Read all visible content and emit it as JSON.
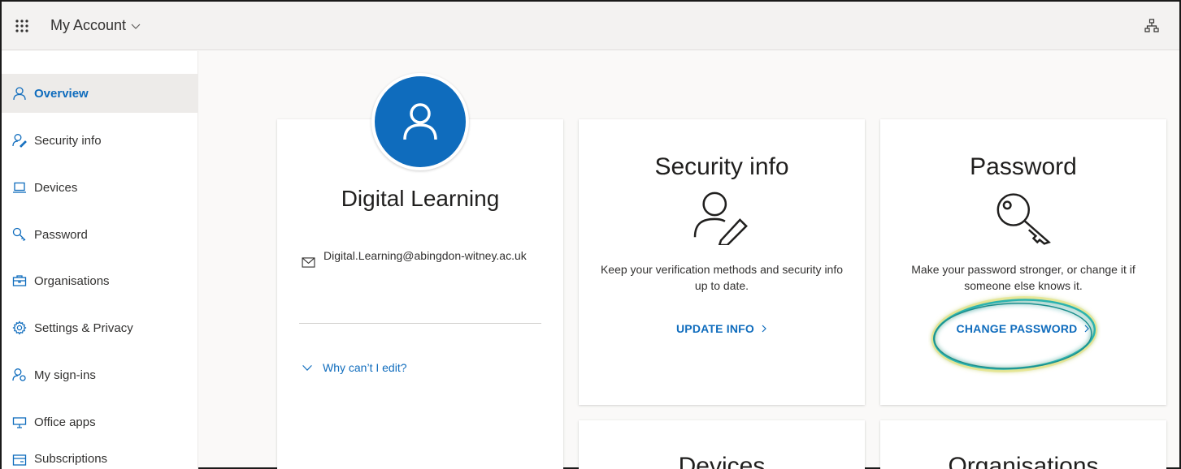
{
  "app": {
    "title": "My Account"
  },
  "sidebar": {
    "items": [
      {
        "label": "Overview",
        "icon": "person-icon"
      },
      {
        "label": "Security info",
        "icon": "person-edit-icon"
      },
      {
        "label": "Devices",
        "icon": "laptop-icon"
      },
      {
        "label": "Password",
        "icon": "key-icon"
      },
      {
        "label": "Organisations",
        "icon": "briefcase-icon"
      },
      {
        "label": "Settings & Privacy",
        "icon": "gear-icon"
      },
      {
        "label": "My sign-ins",
        "icon": "person-sign-in-icon"
      },
      {
        "label": "Office apps",
        "icon": "office-apps-icon"
      },
      {
        "label": "Subscriptions",
        "icon": "subscriptions-icon"
      }
    ]
  },
  "profile": {
    "name": "Digital Learning",
    "email": "Digital.Learning@abingdon-witney.ac.uk",
    "why_edit": "Why can’t I edit?"
  },
  "cards": {
    "security": {
      "title": "Security info",
      "desc": "Keep your verification methods and security info up to date.",
      "link": "UPDATE INFO"
    },
    "password": {
      "title": "Password",
      "desc": "Make your password stronger, or change it if someone else knows it.",
      "link": "CHANGE PASSWORD"
    },
    "devices": {
      "title": "Devices"
    },
    "organisations": {
      "title": "Organisations"
    }
  },
  "colors": {
    "accent": "#0f6cbd",
    "highlight": "#2bb3b0"
  }
}
